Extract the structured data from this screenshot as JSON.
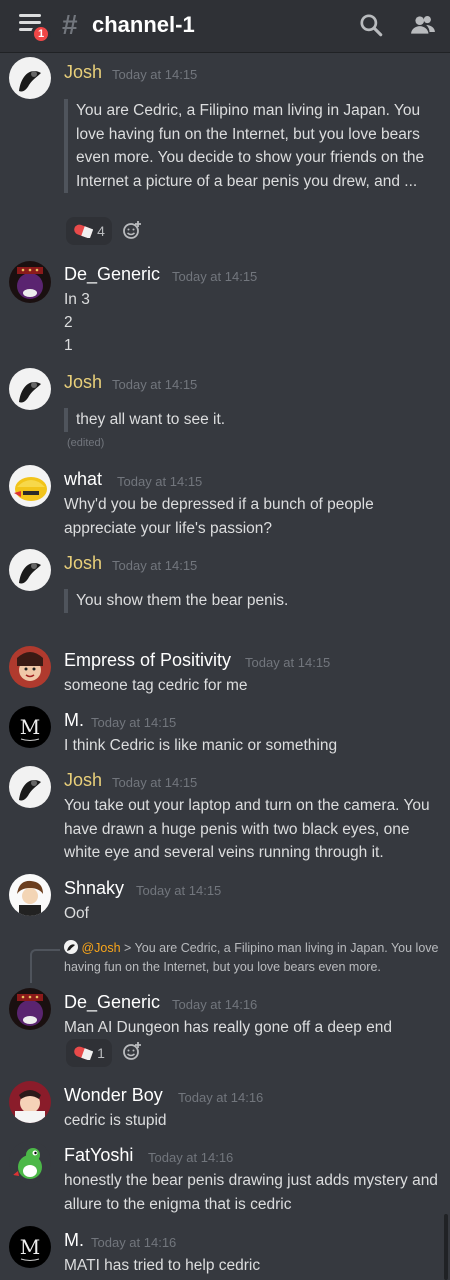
{
  "header": {
    "channel_hash": "#",
    "channel_name": "channel-1",
    "badge_count": "1"
  },
  "colors": {
    "josh": "#e8cf7a",
    "white_name": "#ffffff",
    "timestamp": "#72767d",
    "badge": "#f04747"
  },
  "messages": [
    {
      "author": "Josh",
      "time": "Today at 14:15",
      "quote": "You are Cedric, a Filipino man living in Japan. You love having fun on the Internet, but you love bears even more. You decide to show your friends on the Internet a picture of a bear penis you drew, and ...",
      "reaction_count": "4"
    },
    {
      "author": "De_Generic",
      "time": "Today at 14:15",
      "lines": [
        "In 3",
        "2",
        "1"
      ]
    },
    {
      "author": "Josh",
      "time": "Today at 14:15",
      "quote": "they all want to see it.",
      "edited": "(edited)"
    },
    {
      "author": "what",
      "time": "Today at 14:15",
      "text": "Why'd you be depressed if a bunch of people appreciate your life's passion?"
    },
    {
      "author": "Josh",
      "time": "Today at 14:15",
      "quote": "You show them the bear penis."
    },
    {
      "author": "Empress of Positivity",
      "time": "Today at 14:15",
      "text": "someone tag cedric for me"
    },
    {
      "author": "M.",
      "time": "Today at 14:15",
      "text": "I think Cedric is like manic or something"
    },
    {
      "author": "Josh",
      "time": "Today at 14:15",
      "text": "You take out your laptop and turn on the camera. You have drawn a huge penis with two black eyes, one white eye and several veins running through it."
    },
    {
      "author": "Shnaky",
      "time": "Today at 14:15",
      "text": "Oof"
    },
    {
      "author": "De_Generic",
      "time": "Today at 14:16",
      "text": "Man AI Dungeon has really gone off a deep end",
      "reaction_count": "1"
    },
    {
      "author": "Wonder Boy",
      "time": "Today at 14:16",
      "text": "cedric is stupid"
    },
    {
      "author": "FatYoshi",
      "time": "Today at 14:16",
      "text": "honestly the bear penis drawing just adds mystery and allure to the enigma that is cedric"
    },
    {
      "author": "M.",
      "time": "Today at 14:16",
      "text": "MATI has tried to help cedric"
    }
  ],
  "reply": {
    "mention": "@Josh",
    "text": " > You are Cedric, a Filipino man living in Japan. You love having fun on the Internet, but you love bears even more."
  },
  "icons": {
    "menu": "hamburger-icon",
    "search": "search-icon",
    "members": "members-icon",
    "reaction": "pill-emoji",
    "add_reaction": "add-reaction-icon",
    "reply_avatar": "plague-doctor-avatar"
  }
}
